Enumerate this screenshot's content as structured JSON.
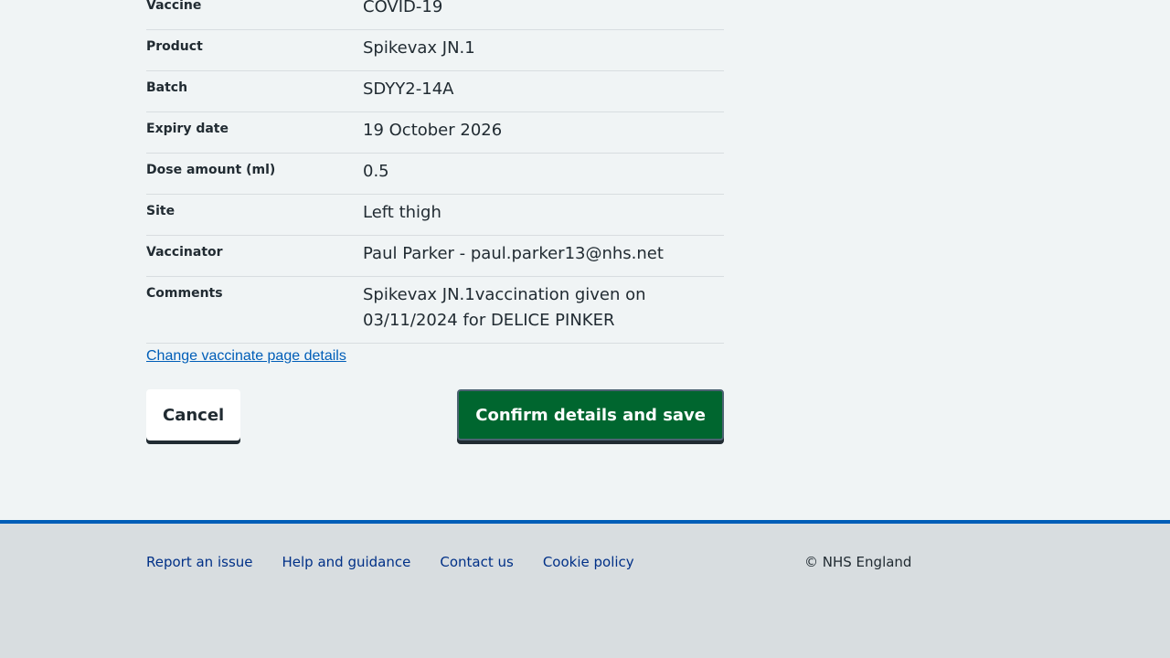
{
  "summary": {
    "rows": [
      {
        "key": "Vaccine",
        "value": "COVID-19"
      },
      {
        "key": "Product",
        "value": "Spikevax JN.1"
      },
      {
        "key": "Batch",
        "value": "SDYY2-14A"
      },
      {
        "key": "Expiry date",
        "value": "19 October 2026"
      },
      {
        "key": "Dose amount (ml)",
        "value": "0.5"
      },
      {
        "key": "Site",
        "value": "Left thigh"
      },
      {
        "key": "Vaccinator",
        "value": "Paul Parker - paul.parker13@nhs.net"
      },
      {
        "key": "Comments",
        "value": "Spikevax JN.1vaccination given on 03/11/2024 for DELICE PINKER"
      }
    ]
  },
  "change_link": "Change vaccinate page details",
  "buttons": {
    "cancel": "Cancel",
    "confirm": "Confirm details and save"
  },
  "footer": {
    "links": [
      "Report an issue",
      "Help and guidance",
      "Contact us",
      "Cookie policy"
    ],
    "copyright": "© NHS England"
  },
  "colors": {
    "page_background": "#f0f4f5",
    "link": "#005eb8",
    "confirm_button": "#00662f",
    "footer_background": "#d8dde0",
    "footer_border": "#005eb8"
  }
}
